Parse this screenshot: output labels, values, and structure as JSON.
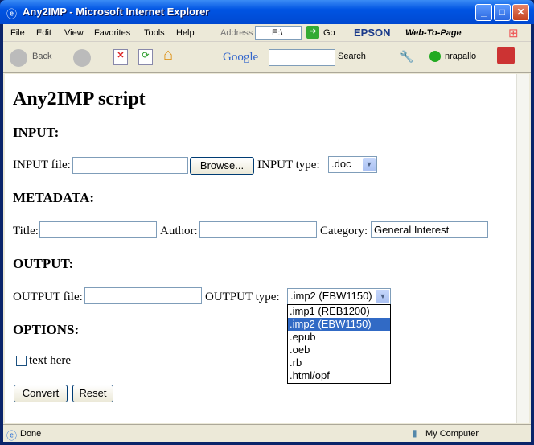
{
  "window": {
    "title": "Any2IMP - Microsoft Internet Explorer"
  },
  "menu": [
    "File",
    "Edit",
    "View",
    "Favorites",
    "Tools",
    "Help"
  ],
  "address": {
    "label": "Address",
    "value": "E:\\",
    "go": "Go"
  },
  "epson": {
    "brand": "EPSON",
    "menu": "Web-To-Page"
  },
  "toolbar": {
    "back": "Back",
    "google": "Google",
    "search": "Search",
    "user": "nrapallo"
  },
  "page": {
    "heading": "Any2IMP script",
    "input": {
      "heading": "INPUT:",
      "file_label": "INPUT file:",
      "file_value": "",
      "browse": "Browse...",
      "type_label": "INPUT type:",
      "type_value": ".doc"
    },
    "metadata": {
      "heading": "METADATA:",
      "title_label": "Title:",
      "author_label": "Author:",
      "category_label": "Category:",
      "category_value": "General Interest"
    },
    "output": {
      "heading": "OUTPUT:",
      "file_label": "OUTPUT file:",
      "type_label": "OUTPUT type:",
      "type_value": ".imp2 (EBW1150)",
      "options": [
        ".imp1 (REB1200)",
        ".imp2 (EBW1150)",
        ".epub",
        ".oeb",
        ".rb",
        ".html/opf"
      ],
      "selected_index": 1
    },
    "options": {
      "heading": "OPTIONS:",
      "checkbox_label": "text here",
      "checked": false
    },
    "convert": "Convert",
    "reset": "Reset"
  },
  "status": {
    "text": "Done",
    "zone": "My Computer"
  }
}
